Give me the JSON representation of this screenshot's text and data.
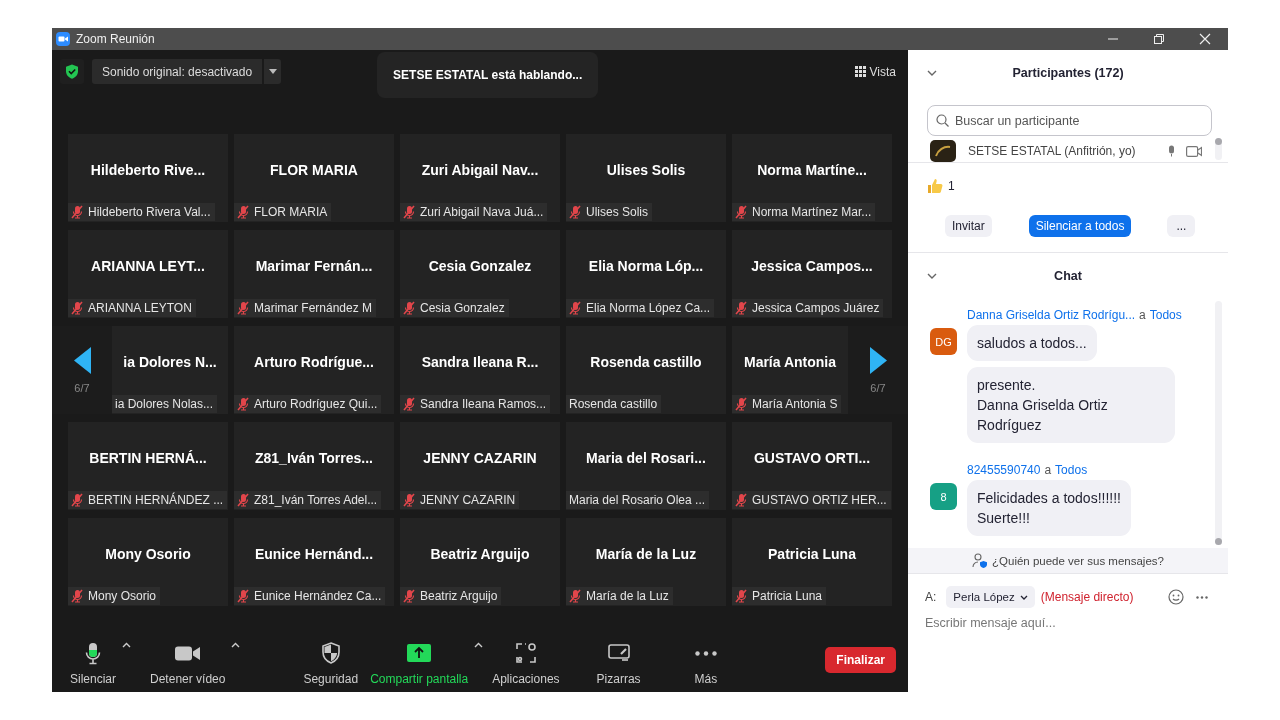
{
  "window": {
    "title": "Zoom Reunión"
  },
  "top_bar": {
    "audio_button": "Sonido original: desactivado",
    "speaking_banner": "SETSE ESTATAL está hablando...",
    "view_button": "Vista"
  },
  "grid": {
    "pager": {
      "previous_page": "6/7",
      "next_page": "6/7"
    },
    "tiles": [
      {
        "name": "Hildeberto Rive...",
        "label": "Hildeberto Rivera Val...",
        "muted": true
      },
      {
        "name": "FLOR MARIA",
        "label": "FLOR MARIA",
        "muted": true
      },
      {
        "name": "Zuri Abigail Nav...",
        "label": "Zuri Abigail Nava Juá...",
        "muted": true
      },
      {
        "name": "Ulises Solis",
        "label": "Ulises Solis",
        "muted": true
      },
      {
        "name": "Norma Martíne...",
        "label": "Norma Martínez Mar...",
        "muted": true
      },
      {
        "name": "ARIANNA LEYT...",
        "label": "ARIANNA LEYTON",
        "muted": true
      },
      {
        "name": "Marimar Fernán...",
        "label": "Marimar Fernández M",
        "muted": true
      },
      {
        "name": "Cesia Gonzalez",
        "label": "Cesia Gonzalez",
        "muted": true
      },
      {
        "name": "Elia Norma Lóp...",
        "label": "Elia Norma López Ca...",
        "muted": true
      },
      {
        "name": "Jessica Campos...",
        "label": "Jessica Campos Juárez",
        "muted": true
      },
      {
        "name": "ia Dolores N...",
        "label": "ia Dolores Nolas...",
        "muted": false,
        "kind": "cut-start"
      },
      {
        "name": "Arturo Rodrígue...",
        "label": "Arturo Rodríguez Qui...",
        "muted": true
      },
      {
        "name": "Sandra Ileana R...",
        "label": "Sandra Ileana Ramos...",
        "muted": true
      },
      {
        "name": "Rosenda castillo",
        "label": "Rosenda castillo",
        "muted": false
      },
      {
        "name": "María Antonia",
        "label": "María Antonia S",
        "muted": true,
        "kind": "cut-end"
      },
      {
        "name": "BERTIN HERNÁ...",
        "label": "BERTIN HERNÁNDEZ ...",
        "muted": true
      },
      {
        "name": "Z81_Iván Torres...",
        "label": "Z81_Iván Torres Adel...",
        "muted": true
      },
      {
        "name": "JENNY CAZARIN",
        "label": "JENNY CAZARIN",
        "muted": true
      },
      {
        "name": "Maria del Rosari...",
        "label": "Maria del Rosario Olea ...",
        "muted": false
      },
      {
        "name": "GUSTAVO ORTI...",
        "label": "GUSTAVO ORTIZ HER...",
        "muted": true
      },
      {
        "name": "Mony Osorio",
        "label": "Mony Osorio",
        "muted": true
      },
      {
        "name": "Eunice Hernánd...",
        "label": "Eunice Hernández Ca...",
        "muted": true
      },
      {
        "name": "Beatriz Arguijo",
        "label": "Beatriz Arguijo",
        "muted": true
      },
      {
        "name": "María de la Luz",
        "label": "María de la Luz",
        "muted": true
      },
      {
        "name": "Patricia Luna",
        "label": "Patricia Luna",
        "muted": true
      }
    ]
  },
  "toolbar": {
    "items": [
      {
        "kind": "mic",
        "label": "Silenciar",
        "caret": true
      },
      {
        "kind": "video",
        "label": "Detener vídeo",
        "caret": true
      },
      {
        "kind": "security",
        "label": "Seguridad",
        "caret": false
      },
      {
        "kind": "share",
        "label": "Compartir pantalla",
        "caret": true
      },
      {
        "kind": "apps",
        "label": "Aplicaciones",
        "caret": false
      },
      {
        "kind": "whiteboard",
        "label": "Pizarras",
        "caret": false
      },
      {
        "kind": "more",
        "label": "Más",
        "caret": false
      }
    ],
    "end_button": "Finalizar"
  },
  "participants": {
    "title": "Participantes (172)",
    "search": {
      "placeholder": "Buscar un participante"
    },
    "rows": [
      {
        "name": "SETSE ESTATAL (Anfitrión, yo)"
      }
    ],
    "reaction": {
      "count": "1"
    },
    "buttons": [
      {
        "label": "Invitar",
        "primary": false
      },
      {
        "label": "Silenciar a todos",
        "primary": true
      },
      {
        "label": "...",
        "primary": false
      }
    ]
  },
  "chat": {
    "title": "Chat",
    "messages": [
      {
        "sender": "Danna Griselda Ortiz Rodrígu...",
        "connector": "a",
        "recipient": "Todos",
        "initials": "DG",
        "color": "#d95b0f",
        "bubbles": [
          "saludos a todos...",
          "presente.\nDanna Griselda Ortiz Rodríguez"
        ]
      },
      {
        "sender": "82455590740",
        "connector": "a",
        "recipient": "Todos",
        "initials": "8",
        "color": "#16a085",
        "bubbles": [
          "Felicidades a todos!!!!!!\nSuerte!!!"
        ]
      }
    ],
    "privacy_link": "¿Quién puede ver sus mensajes?",
    "to_label": "A:",
    "recipient": "Perla López",
    "mode": "(Mensaje directo)",
    "input": {
      "placeholder": "Escribir mensaje aquí..."
    }
  }
}
